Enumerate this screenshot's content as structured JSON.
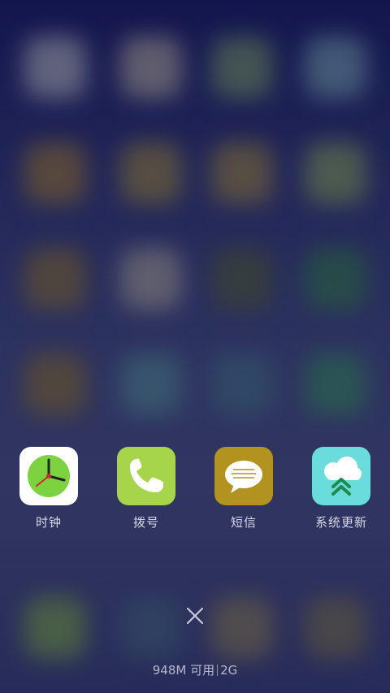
{
  "recent_apps": [
    {
      "name": "clock",
      "label": "时钟",
      "icon": "clock-icon",
      "bg": "#ffffff"
    },
    {
      "name": "dialer",
      "label": "拨号",
      "icon": "phone-icon",
      "bg": "#a6d54c"
    },
    {
      "name": "messages",
      "label": "短信",
      "icon": "message-icon",
      "bg": "#b39320"
    },
    {
      "name": "system-update",
      "label": "系统更新",
      "icon": "cloud-update-icon",
      "bg": "#6bdcdc"
    }
  ],
  "close_icon": "close-icon",
  "memory": {
    "available": "948M 可用",
    "total": "2G"
  },
  "colors": {
    "label": "#d7d9e6",
    "clock_face": "#7dd33f",
    "update_arrow": "#1e8a50"
  }
}
